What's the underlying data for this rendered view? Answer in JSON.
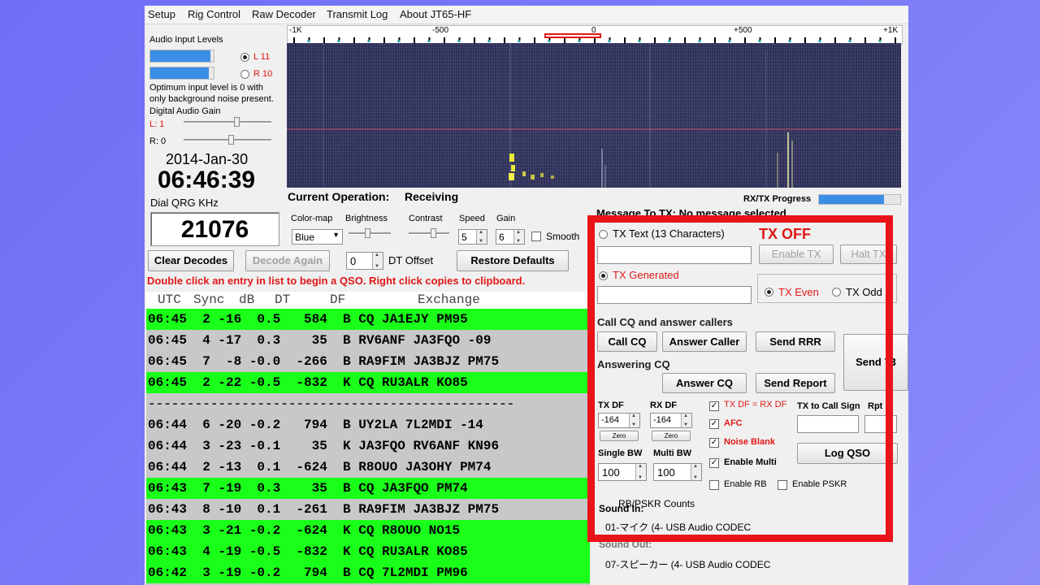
{
  "menu": [
    "Setup",
    "Rig Control",
    "Raw Decoder",
    "Transmit Log",
    "About JT65-HF"
  ],
  "audio": {
    "title": "Audio Input Levels",
    "left_level_label": "L 11",
    "right_level_label": "R 10",
    "left_level": 0.95,
    "right_level": 0.92,
    "hint_line1": "Optimum input level is 0 with",
    "hint_line2": "only background noise present.",
    "gain_title": "Digital Audio Gain",
    "gain_left": "L: 1",
    "gain_right": "R: 0"
  },
  "clock": {
    "date": "2014-Jan-30",
    "time": "06:46:39",
    "dial_label": "Dial QRG KHz",
    "dial_value": "21076"
  },
  "scale": {
    "labels": [
      "-1K",
      "-500",
      "0",
      "+500",
      "+1K"
    ]
  },
  "status": {
    "current_operation_label": "Current Operation:",
    "current_operation_value": "Receiving",
    "rxtx_label": "RX/TX Progress",
    "rxtx_progress": 0.8,
    "message_partial": "Message To TX: No message selected"
  },
  "controls": {
    "colormap_label": "Color-map",
    "colormap_value": "Blue",
    "brightness_label": "Brightness",
    "contrast_label": "Contrast",
    "speed_label": "Speed",
    "speed_value": "5",
    "gain_label": "Gain",
    "gain_value": "6",
    "smooth_label": "Smooth"
  },
  "buttons": {
    "clear_decodes": "Clear Decodes",
    "decode_again": "Decode Again",
    "dt_offset_value": "0",
    "dt_offset_label": "DT Offset",
    "restore_defaults": "Restore Defaults"
  },
  "instruction": "Double click an entry in list to begin a QSO.  Right click copies to clipboard.",
  "decode_columns": {
    "utc": "UTC",
    "sync": "Sync",
    "db": "dB",
    "dt": "DT",
    "df": "DF",
    "exchange": "Exchange"
  },
  "decodes": [
    {
      "text": "06:45  2 -16  0.5   584  B CQ JA1EJY PM95",
      "highlight": true
    },
    {
      "text": "06:45  4 -17  0.3    35  B RV6ANF JA3FQO -09",
      "highlight": false
    },
    {
      "text": "06:45  7  -8 -0.0  -266  B RA9FIM JA3BJZ PM75",
      "highlight": false
    },
    {
      "text": "06:45  2 -22 -0.5  -832  K CQ RU3ALR KO85",
      "highlight": true
    },
    {
      "text": "-----------------------------------------------",
      "separator": true
    },
    {
      "text": "06:44  6 -20 -0.2   794  B UY2LA 7L2MDI -14",
      "highlight": false
    },
    {
      "text": "06:44  3 -23 -0.1    35  K JA3FQO RV6ANF KN96",
      "highlight": false
    },
    {
      "text": "06:44  2 -13  0.1  -624  B R8OUO JA3OHY PM74",
      "highlight": false
    },
    {
      "text": "06:43  7 -19  0.3    35  B CQ JA3FQO PM74",
      "highlight": true
    },
    {
      "text": "06:43  8 -10  0.1  -261  B RA9FIM JA3BJZ PM75",
      "highlight": false
    },
    {
      "text": "06:43  3 -21 -0.2  -624  K CQ R8OUO NO15",
      "highlight": true
    },
    {
      "text": "06:43  4 -19 -0.5  -832  K CQ RU3ALR KO85",
      "highlight": true
    },
    {
      "text": "06:42  3 -19 -0.2   794  B CQ 7L2MDI PM96",
      "highlight": true
    }
  ],
  "tx": {
    "tx_text_label": "TX Text (13 Characters)",
    "tx_off": "TX OFF",
    "enable_tx": "Enable TX",
    "halt_tx": "Halt TX",
    "tx_generated_label": "TX Generated",
    "tx_even": "TX Even",
    "tx_odd": "TX Odd",
    "call_cq_title": "Call CQ and answer callers",
    "call_cq": "Call CQ",
    "answer_caller": "Answer Caller",
    "send_rrr": "Send RRR",
    "send_73": "Send 73",
    "answering_cq_title": "Answering CQ",
    "answer_cq": "Answer CQ",
    "send_report": "Send Report",
    "tx_df_label": "TX DF",
    "tx_df_value": "-164",
    "rx_df_label": "RX DF",
    "rx_df_value": "-164",
    "zero": "Zero",
    "txdf_eq_rxdf": "TX DF = RX DF",
    "afc": "AFC",
    "noise_blank": "Noise Blank",
    "enable_multi": "Enable Multi",
    "enable_rb": "Enable RB",
    "enable_pskr": "Enable PSKR",
    "tx_to_call_label": "TX to Call Sign",
    "rpt_label": "Rpt (-",
    "log_qso": "Log QSO",
    "single_bw_label": "Single BW",
    "single_bw_value": "100",
    "multi_bw_label": "Multi BW",
    "multi_bw_value": "100",
    "rb_pskr_counts": "RB/PSKR Counts",
    "sound_in_label": "Sound In:",
    "sound_in_device": "01-マイク (4- USB Audio CODEC",
    "sound_out_label": "Sound Out:",
    "sound_out_device": "07-スピーカー (4- USB Audio CODEC"
  },
  "colors": {
    "highlight_row": "#19ff19",
    "frame": "#e8141a",
    "tx_red": "#e01818"
  }
}
